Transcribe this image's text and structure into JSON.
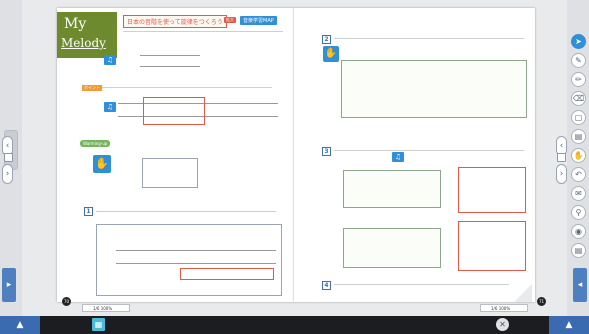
{
  "app": {
    "left_page_num": "70",
    "right_page_num": "71"
  },
  "left_page": {
    "logo_line1": "My",
    "logo_line2": "Melody",
    "title": "日本の音階を使って旋律をつくろう",
    "title_badge": "拡大",
    "title_link": "音楽学習MAP",
    "warming_up_label": "Warming-up",
    "section1_num": "1",
    "intro_tag": "ポイント"
  },
  "right_page": {
    "section2_num": "2",
    "section3_num": "3",
    "section4_num": "4"
  },
  "toolbar": {
    "left_status": "1/6 100%",
    "right_status": "1/6 100%"
  },
  "colors": {
    "accent_blue": "#2f8fd8",
    "logo_green": "#6e8a2e",
    "title_red": "#e05a4b"
  }
}
